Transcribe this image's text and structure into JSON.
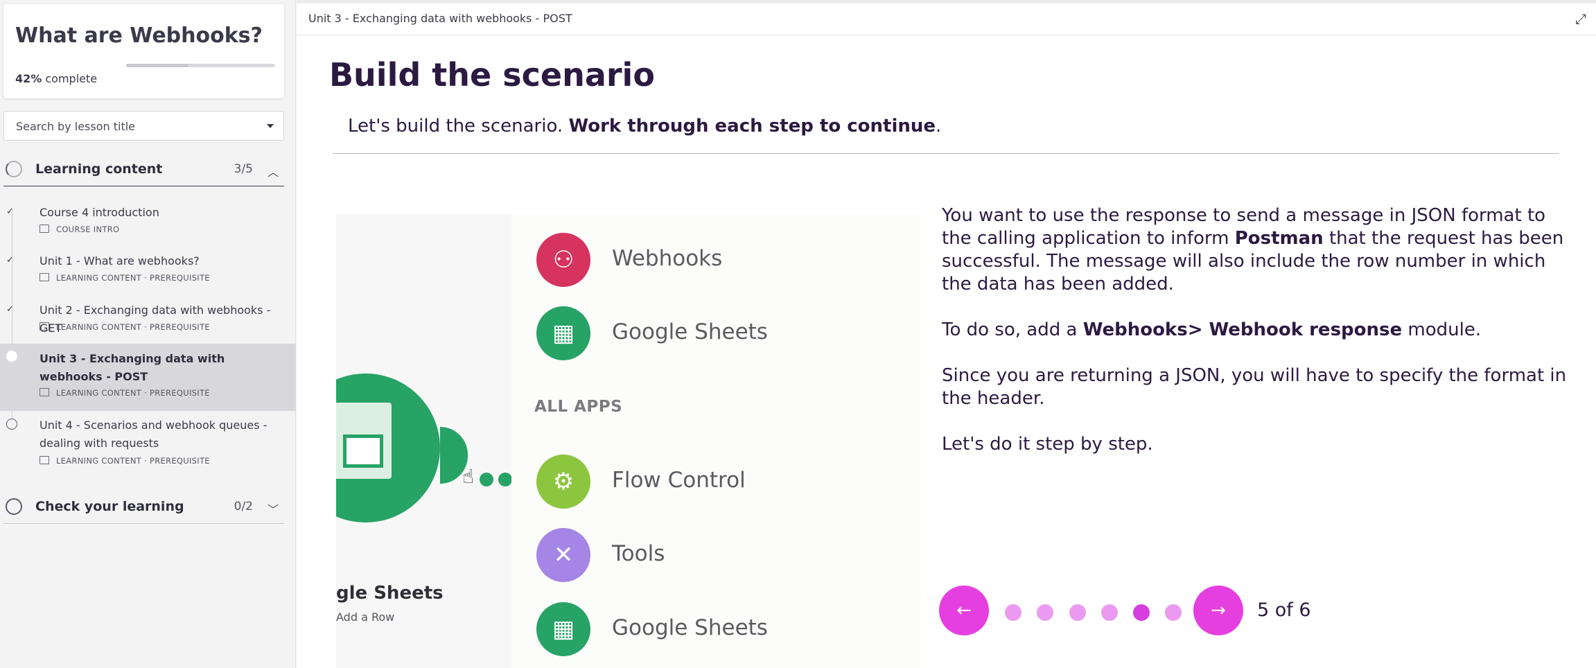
{
  "course": {
    "title": "What are Webhooks?",
    "progress_percent": 42,
    "progress_value": "42%",
    "progress_suffix": " complete"
  },
  "search": {
    "placeholder": "Search by lesson title"
  },
  "sections": [
    {
      "label": "Learning content",
      "count": "3/5",
      "expanded": true
    },
    {
      "label": "Check your learning",
      "count": "0/2",
      "expanded": false
    }
  ],
  "lessons": [
    {
      "title": "Course 4 introduction",
      "meta": "COURSE INTRO",
      "status": "complete"
    },
    {
      "title": "Unit 1 - What are webhooks?",
      "meta": "LEARNING CONTENT · PREREQUISITE",
      "status": "complete"
    },
    {
      "title": "Unit 2 - Exchanging data with webhooks - GET",
      "meta": "LEARNING CONTENT · PREREQUISITE",
      "status": "complete"
    },
    {
      "title": "Unit 3 - Exchanging data with webhooks - POST",
      "meta": "LEARNING CONTENT · PREREQUISITE",
      "status": "current"
    },
    {
      "title": "Unit 4 - Scenarios and webhook queues - dealing with requests",
      "meta": "LEARNING CONTENT · PREREQUISITE",
      "status": "incomplete"
    }
  ],
  "topbar": {
    "breadcrumb": "Unit 3 - Exchanging data with webhooks - POST"
  },
  "main": {
    "heading": "Build the scenario",
    "intro_plain": "Let's build the scenario. ",
    "intro_bold": "Work through each step to continue",
    "intro_end": "."
  },
  "figure": {
    "module_label": "gle Sheets",
    "module_sub": "Add a Row",
    "apps": [
      {
        "name": "Webhooks",
        "icon": "webhook-icon",
        "color": "#d6335f"
      },
      {
        "name": "Google Sheets",
        "icon": "google-sheets-icon",
        "color": "#27a365"
      },
      {
        "name": "Flow Control",
        "icon": "gear-icon",
        "color": "#8cc63f"
      },
      {
        "name": "Tools",
        "icon": "tools-icon",
        "color": "#a585e6"
      },
      {
        "name": "Google Sheets",
        "icon": "google-sheets-icon",
        "color": "#27a365"
      }
    ],
    "all_apps_label": "ALL APPS"
  },
  "step_text": {
    "p1_a": "You want to use the response to send a message in JSON format to the calling application to inform ",
    "p1_b": "Postman",
    "p1_c": " that the request has been successful. The message will also include the row number in which the data has been added.",
    "p2_a": "To do so, add a ",
    "p2_b": "Webhooks> Webhook response",
    "p2_c": " module.",
    "p3": "Since you are returning a JSON, you will have to specify the format in the header.",
    "p4": "Let's do it step by step."
  },
  "pager": {
    "current": 5,
    "total": 6,
    "label": "5 of 6",
    "accent": "#e53fe0"
  }
}
